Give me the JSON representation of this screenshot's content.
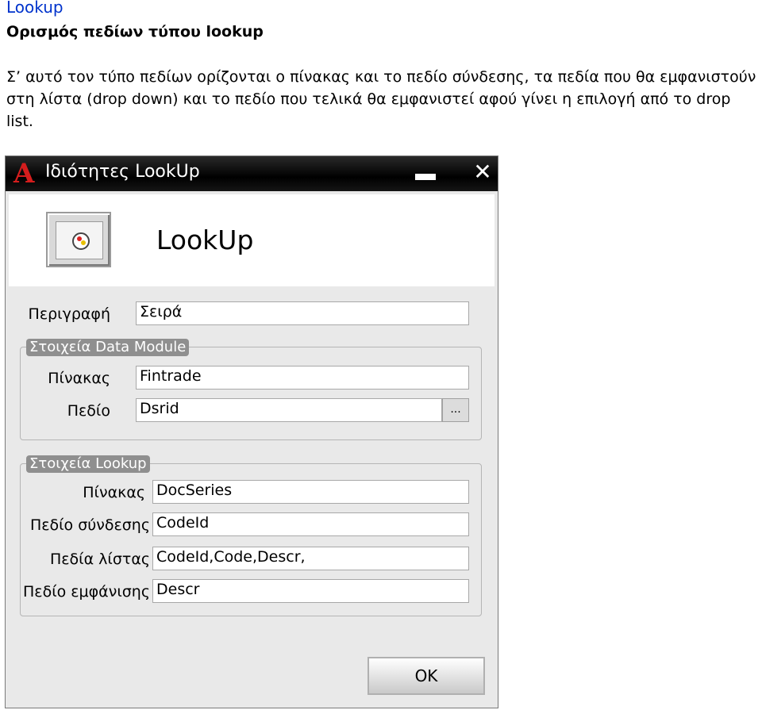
{
  "document": {
    "title": "Lookup",
    "subtitle": "Ορισμός πεδίων τύπου lookup",
    "body": "Σ’ αυτό τον τύπο πεδίων ορίζονται ο πίνακας και το πεδίο σύνδεσης, τα πεδία που θα εμφανιστούν στη λίστα (drop down) και το πεδίο που τελικά θα εμφανιστεί αφού γίνει η επιλογή από το drop list."
  },
  "window": {
    "app_icon": "A",
    "title": "Ιδιότητες LookUp",
    "close_glyph": "✕",
    "header_title": "LookUp",
    "description": {
      "label": "Περιγραφή",
      "value": "Σειρά"
    },
    "data_module": {
      "legend": "Στοιχεία Data Module",
      "table": {
        "label": "Πίνακας",
        "value": "Fintrade"
      },
      "field": {
        "label": "Πεδίο",
        "value": "Dsrid"
      },
      "browse_label": "..."
    },
    "lookup": {
      "legend": "Στοιχεία Lookup",
      "table": {
        "label": "Πίνακας",
        "value": "DocSeries"
      },
      "link_field": {
        "label": "Πεδίο σύνδεσης",
        "value": "CodeId"
      },
      "list_fields": {
        "label": "Πεδία λίστας",
        "value": "CodeId,Code,Descr,"
      },
      "display_field": {
        "label": "Πεδίο εμφάνισης",
        "value": "Descr"
      }
    },
    "ok_label": "OK"
  }
}
